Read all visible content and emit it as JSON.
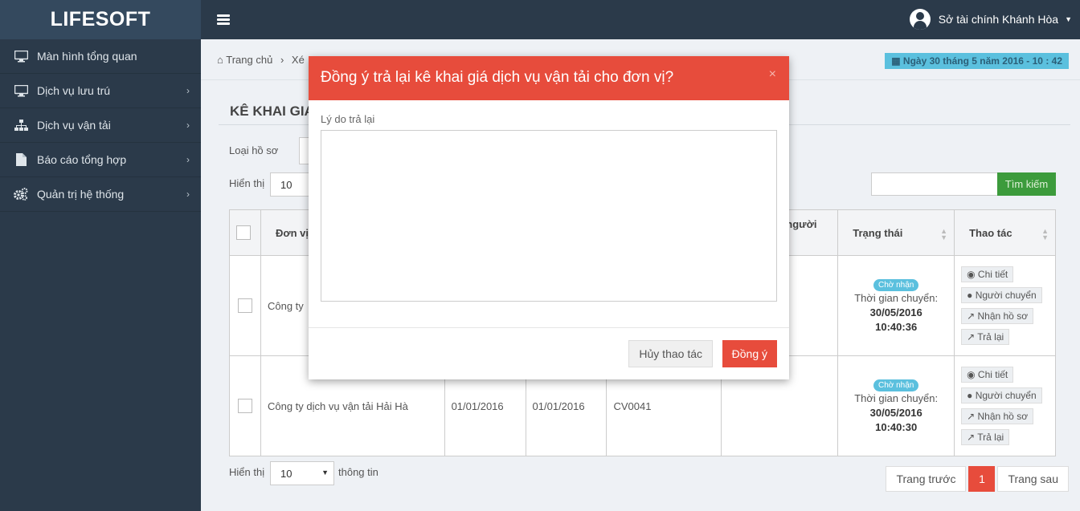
{
  "app": {
    "brand": "LIFESOFT"
  },
  "header": {
    "user_name": "Sở tài chính Khánh Hòa"
  },
  "sidebar": {
    "items": [
      {
        "label": "Màn hình tổng quan",
        "icon": "monitor-icon"
      },
      {
        "label": "Dịch vụ lưu trú",
        "icon": "monitor-icon"
      },
      {
        "label": "Dịch vụ vận tải",
        "icon": "sitemap-icon"
      },
      {
        "label": "Báo cáo tổng hợp",
        "icon": "file-icon"
      },
      {
        "label": "Quản trị hệ thống",
        "icon": "gears-icon"
      }
    ]
  },
  "breadcrumb": {
    "home": "Trang chủ",
    "sep": "›",
    "next": "Xé"
  },
  "date_badge": "Ngày 30 tháng 5 năm 2016 - 10 : 42",
  "page": {
    "title": "KÊ KHAI GIA",
    "filter_label": "Loại hồ sơ",
    "show_label": "Hiển thị",
    "show_value": "10",
    "search_button": "Tìm kiếm"
  },
  "table": {
    "headers": {
      "unit": "Đơn vị",
      "sender": "người",
      "status": "Trạng thái",
      "actions": "Thao tác"
    },
    "rows": [
      {
        "unit": "Công ty",
        "date1": "",
        "date2": "",
        "code": "",
        "status": "Chờ nhận",
        "time_label": "Thời gian chuyển:",
        "time_date": "30/05/2016",
        "time_clock": "10:40:36",
        "actions": [
          "Chi tiết",
          "Người chuyển",
          "Nhận hồ sơ",
          "Trả lại"
        ]
      },
      {
        "unit": "Công ty dịch vụ vận tải Hải Hà",
        "date1": "01/01/2016",
        "date2": "01/01/2016",
        "code": "CV0041",
        "status": "Chờ nhận",
        "time_label": "Thời gian chuyển:",
        "time_date": "30/05/2016",
        "time_clock": "10:40:30",
        "actions": [
          "Chi tiết",
          "Người chuyển",
          "Nhận hồ sơ",
          "Trả lại"
        ]
      }
    ]
  },
  "footer": {
    "show_label": "Hiển thị",
    "show_value": "10",
    "info": "thông tin",
    "prev": "Trang trước",
    "current": "1",
    "next": "Trang sau"
  },
  "modal": {
    "title": "Đồng ý trả lại kê khai giá dịch vụ vận tải cho đơn vị?",
    "close": "×",
    "field_label": "Lý do trả lại",
    "field_value": "",
    "cancel": "Hủy thao tác",
    "ok": "Đồng ý"
  },
  "colors": {
    "primary_red": "#e74c3c",
    "sidebar": "#2b3a4a",
    "info": "#5bc0de",
    "success": "#3c9b3c"
  }
}
